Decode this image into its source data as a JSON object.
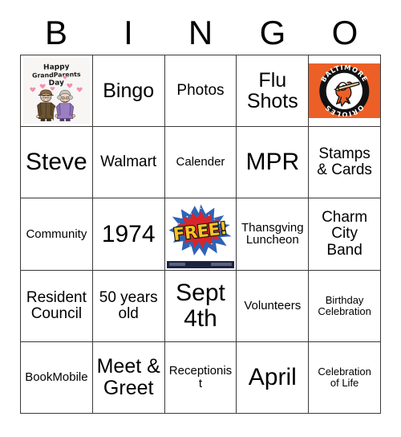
{
  "card": {
    "title_letters": [
      "B",
      "I",
      "N",
      "G",
      "O"
    ],
    "colors": {
      "grid_line": "#3a3a3a",
      "orioles_orange": "#ec6027",
      "free_burst_blue": "#2f63b5",
      "free_burst_red": "#d8252b",
      "free_text_yellow": "#f6c324",
      "free_footer_navy": "#1b2340",
      "heart_pink": "#f48fb1"
    },
    "rows": [
      [
        {
          "type": "image",
          "name": "happy-grandparents-day-image",
          "alt": "Happy Grandparents Day",
          "art_text": {
            "line1": "Happy",
            "line2": "GrandParents",
            "line3": "Day"
          }
        },
        {
          "type": "text",
          "name": "bingo",
          "text": "Bingo",
          "size": "lg"
        },
        {
          "type": "text",
          "name": "photos",
          "text": "Photos",
          "size": "md"
        },
        {
          "type": "text",
          "name": "flu-shots",
          "text": "Flu Shots",
          "size": "lg"
        },
        {
          "type": "image",
          "name": "baltimore-orioles-logo",
          "alt": "Baltimore Orioles",
          "art_text": {
            "top": "BALTIMORE",
            "bottom": "ORIOLES"
          }
        }
      ],
      [
        {
          "type": "text",
          "name": "steve",
          "text": "Steve",
          "size": "xl"
        },
        {
          "type": "text",
          "name": "walmart",
          "text": "Walmart",
          "size": "md"
        },
        {
          "type": "text",
          "name": "calender",
          "text": "Calender",
          "size": "sm"
        },
        {
          "type": "text",
          "name": "mpr",
          "text": "MPR",
          "size": "xl"
        },
        {
          "type": "text",
          "name": "stamps-and-cards",
          "text": "Stamps & Cards",
          "size": "md"
        }
      ],
      [
        {
          "type": "text",
          "name": "community",
          "text": "Community",
          "size": "sm"
        },
        {
          "type": "text",
          "name": "1974",
          "text": "1974",
          "size": "xl"
        },
        {
          "type": "image",
          "name": "free-space-image",
          "alt": "FREE",
          "art_text": {
            "label": "FREE!"
          }
        },
        {
          "type": "text",
          "name": "thansgving-luncheon",
          "text": "Thansgving Luncheon",
          "size": "sm"
        },
        {
          "type": "text",
          "name": "charm-city-band",
          "text": "Charm City Band",
          "size": "md"
        }
      ],
      [
        {
          "type": "text",
          "name": "resident-council",
          "text": "Resident Council",
          "size": "md"
        },
        {
          "type": "text",
          "name": "50-years-old",
          "text": "50 years old",
          "size": "md"
        },
        {
          "type": "text",
          "name": "sept-4th",
          "text": "Sept 4th",
          "size": "xl"
        },
        {
          "type": "text",
          "name": "volunteers",
          "text": "Volunteers",
          "size": "sm"
        },
        {
          "type": "text",
          "name": "birthday-celebration",
          "text": "Birthday Celebration",
          "size": "xs"
        }
      ],
      [
        {
          "type": "text",
          "name": "bookmobile",
          "text": "BookMobile",
          "size": "sm"
        },
        {
          "type": "text",
          "name": "meet-and-greet",
          "text": "Meet & Greet",
          "size": "lg"
        },
        {
          "type": "text",
          "name": "receptionist",
          "text": "Receptionist",
          "size": "sm"
        },
        {
          "type": "text",
          "name": "april",
          "text": "April",
          "size": "xl"
        },
        {
          "type": "text",
          "name": "celebration-of-life",
          "text": "Celebration of Life",
          "size": "xs"
        }
      ]
    ]
  }
}
